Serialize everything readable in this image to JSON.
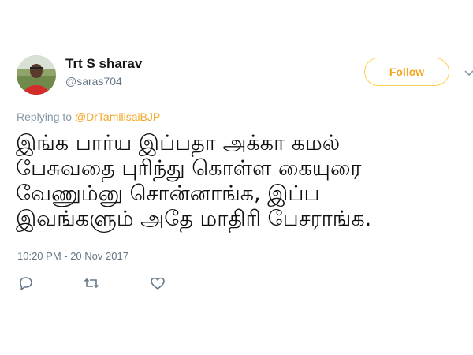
{
  "user": {
    "name": "Trt S sharav",
    "handle": "@saras704"
  },
  "follow_label": "Follow",
  "reply_context": {
    "prefix": "Replying to",
    "mention": "@DrTamilisaiBJP"
  },
  "tweet_lines": [
    "இங்க பார்ய இப்பதா அக்கா கமல்",
    "பேசுவதை புரிந்து கொள்ள கையுரை",
    "வேணும்னு சொன்னாங்க, இப்ப",
    "இவங்களும் அதே மாதிரி பேசராங்க."
  ],
  "timestamp": "10:20 PM - 20 Nov 2017",
  "colors": {
    "accent": "#f5a623",
    "follow_border": "#ffd04d",
    "secondary_text": "#657786",
    "icon_gray": "#657786"
  },
  "icons": {
    "reply": "reply-icon",
    "retweet": "retweet-icon",
    "like": "heart-icon",
    "more": "chevron-down-icon"
  }
}
